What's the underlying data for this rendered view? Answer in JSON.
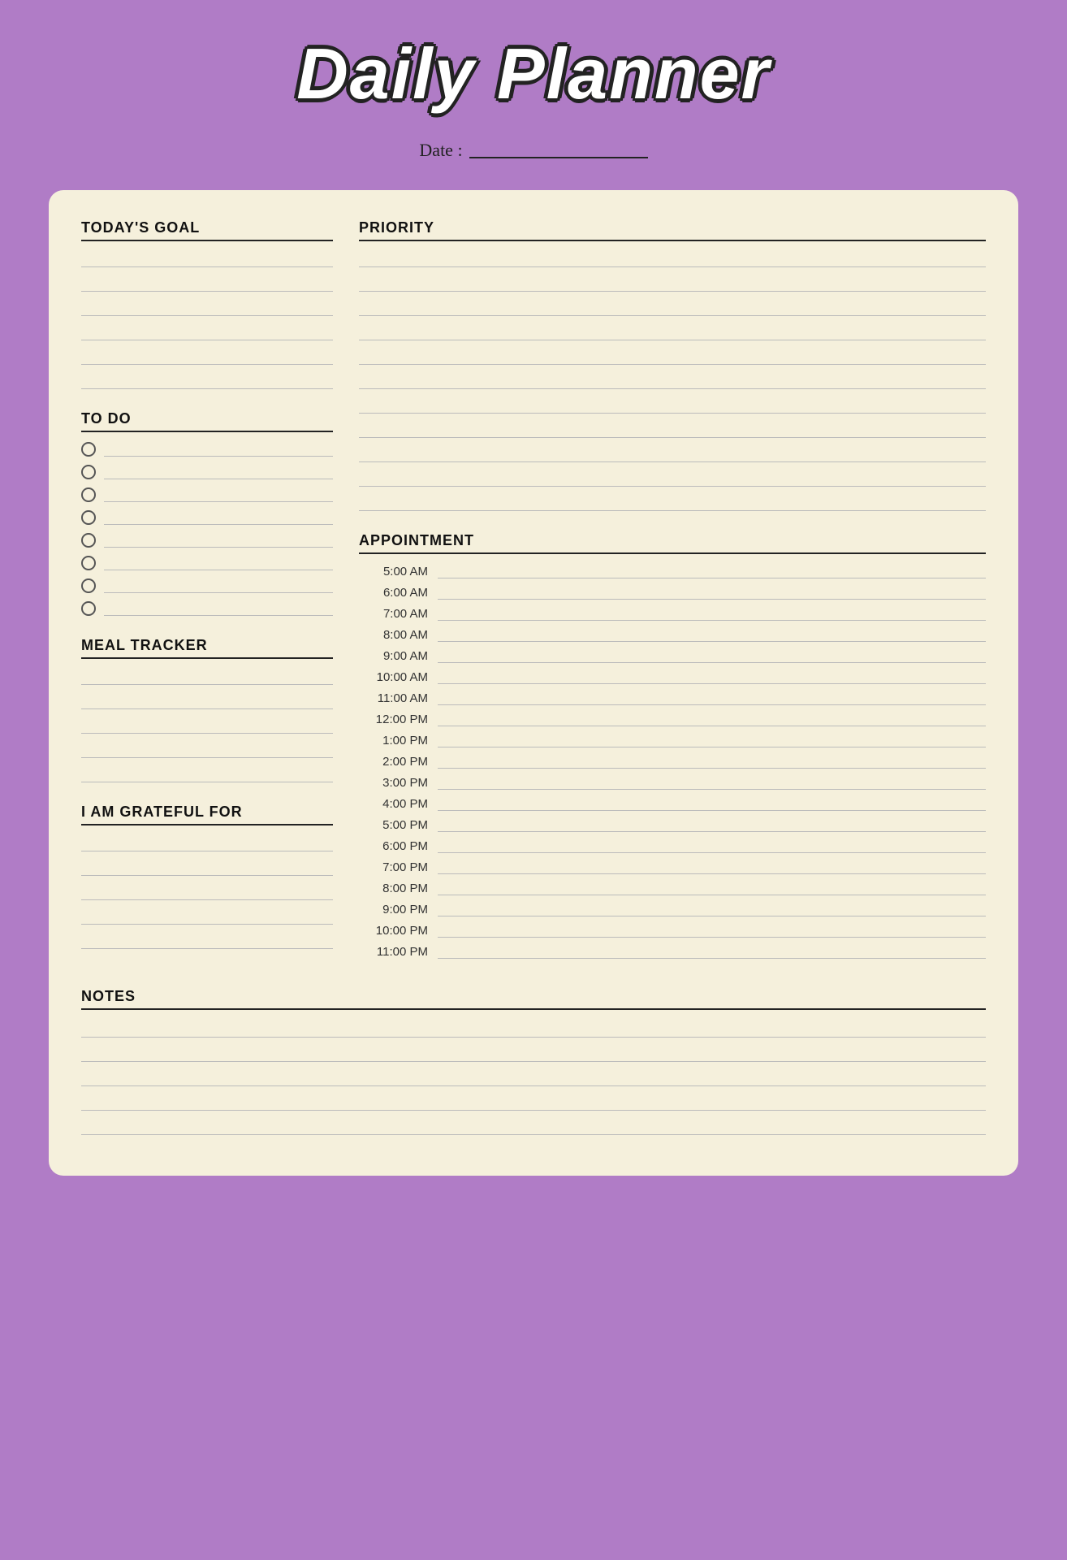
{
  "title": "Daily Planner",
  "date_label": "Date :",
  "sections": {
    "todays_goal": "TODAY'S GOAL",
    "priority": "PRIORITY",
    "todo": "TO DO",
    "meal_tracker": "MEAL TRACKER",
    "grateful": "I AM GRATEFUL FOR",
    "appointment": "APPOINTMENT",
    "notes": "NOTES"
  },
  "appointment_times": [
    "5:00 AM",
    "6:00 AM",
    "7:00 AM",
    "8:00 AM",
    "9:00 AM",
    "10:00 AM",
    "11:00 AM",
    "12:00 PM",
    "1:00 PM",
    "2:00 PM",
    "3:00 PM",
    "4:00 PM",
    "5:00 PM",
    "6:00 PM",
    "7:00 PM",
    "8:00 PM",
    "9:00 PM",
    "10:00 PM",
    "11:00 PM"
  ],
  "todo_items": 8,
  "goal_lines": 6,
  "priority_lines": 11,
  "meal_lines": 5,
  "grateful_lines": 5,
  "notes_lines": 5
}
